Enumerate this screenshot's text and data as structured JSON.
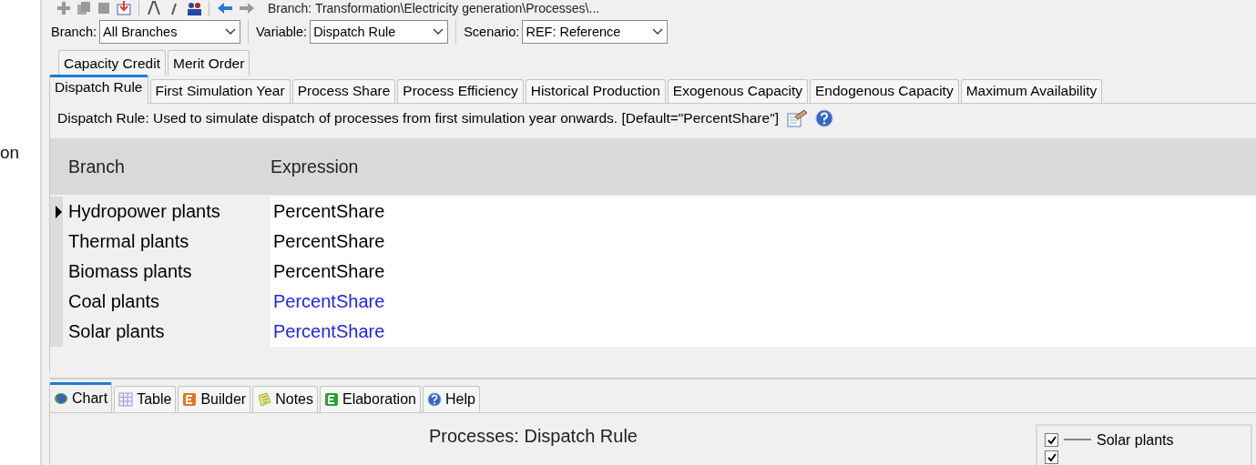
{
  "sidebar": {
    "text": "on"
  },
  "toolbar": {
    "path": "Branch: Transformation\\Electricity generation\\Processes\\..."
  },
  "selectors": [
    {
      "label": "Branch:",
      "value": "All Branches"
    },
    {
      "label": "Variable:",
      "value": "Dispatch Rule"
    },
    {
      "label": "Scenario:",
      "value": "REF: Reference"
    }
  ],
  "tab_rows": [
    [
      {
        "label": "Capacity Credit",
        "selected": false
      },
      {
        "label": "Merit Order",
        "selected": false
      }
    ],
    [
      {
        "label": "Dispatch Rule",
        "selected": true
      },
      {
        "label": "First Simulation Year",
        "selected": false
      },
      {
        "label": "Process Share",
        "selected": false
      },
      {
        "label": "Process Efficiency",
        "selected": false
      },
      {
        "label": "Historical Production",
        "selected": false
      },
      {
        "label": "Exogenous Capacity",
        "selected": false
      },
      {
        "label": "Endogenous Capacity",
        "selected": false
      },
      {
        "label": "Maximum Availability",
        "selected": false
      }
    ]
  ],
  "description": "Dispatch Rule: Used to simulate dispatch of processes from first simulation year onwards. [Default=\"PercentShare\"]",
  "table": {
    "columns": [
      "Branch",
      "Expression"
    ],
    "rows": [
      {
        "branch": "Hydropower plants",
        "expression": "PercentShare",
        "selected": true,
        "color": "#000000"
      },
      {
        "branch": "Thermal plants",
        "expression": "PercentShare",
        "selected": false,
        "color": "#000000"
      },
      {
        "branch": "Biomass plants",
        "expression": "PercentShare",
        "selected": false,
        "color": "#000000"
      },
      {
        "branch": "Coal plants",
        "expression": "PercentShare",
        "selected": false,
        "color": "#2222ee"
      },
      {
        "branch": "Solar plants",
        "expression": "PercentShare",
        "selected": false,
        "color": "#2222ee"
      }
    ]
  },
  "bottom_tabs": [
    {
      "label": "Chart",
      "kind": "chart",
      "selected": true
    },
    {
      "label": "Table",
      "kind": "table",
      "selected": false
    },
    {
      "label": "Builder",
      "kind": "builder",
      "selected": false
    },
    {
      "label": "Notes",
      "kind": "notes",
      "selected": false
    },
    {
      "label": "Elaboration",
      "kind": "elaboration",
      "selected": false
    },
    {
      "label": "Help",
      "kind": "help",
      "selected": false
    }
  ],
  "chart": {
    "title": "Processes: Dispatch Rule",
    "legend": [
      {
        "label": "Solar plants",
        "checked": true
      },
      {
        "checked": true
      }
    ]
  }
}
